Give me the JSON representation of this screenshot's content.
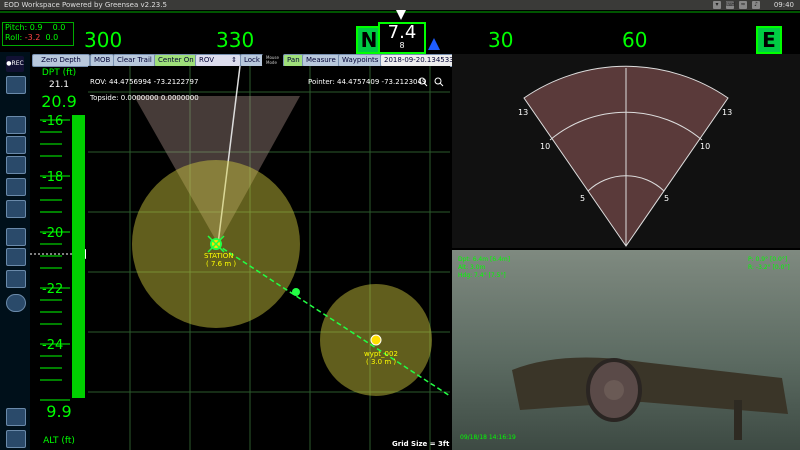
{
  "system_bar": {
    "title": "EOD Workspace Powered by Greensea v2.23.5",
    "clock": "09:40"
  },
  "attitude": {
    "pitch_label": "Pitch:",
    "pitch_a": "0.9",
    "pitch_b": "0.0",
    "roll_label": "Roll:",
    "roll_a": "-3.2",
    "roll_b": "0.0"
  },
  "compass": {
    "ticks": [
      "300",
      "330",
      "30",
      "60"
    ],
    "north": "N",
    "east": "E",
    "heading": "7.4",
    "heading_sub": "8"
  },
  "depth_gauge": {
    "title": "DPT (ft)",
    "setpoint": "21.1",
    "current": "20.9",
    "ticks": [
      "-16",
      "-18",
      "-20",
      "-22",
      "-24"
    ],
    "altitude": "9.9",
    "alt_label": "ALT (ft)"
  },
  "toolbar": {
    "zero_depth": "Zero Depth",
    "mob": "MOB",
    "clear_trail": "Clear Trail",
    "center_on": "Center On",
    "center_select": "ROV",
    "lock": "Lock",
    "mouse_mode": "Mouse Mode",
    "pan": "Pan",
    "measure": "Measure",
    "waypoints": "Waypoints",
    "timestamp": "2018-09-20.134533"
  },
  "map": {
    "rov_pos": "ROV: 44.4756994 -73.2122797",
    "topside_pos": "Topside: 0.0000000 0.0000000",
    "pointer_pos": "Pointer: 44.4757409 -73.2123049",
    "station_label": "STATION",
    "station_radius": "( 7.6 m )",
    "wypt_label": "wypt_002",
    "wypt_radius": "( 3.0 m )",
    "grid_size": "Grid Size = 3ft"
  },
  "sonar": {
    "ring_labels": [
      "13",
      "13",
      "10",
      "10",
      "5",
      "5"
    ]
  },
  "camera": {
    "dpt": "Dpt: 6.4m [6.4m]",
    "alt": "Alt: 3.0m",
    "hdg": "Hdg: 7.4° [7.5°]",
    "p": "P: 0.9° [0.0°]",
    "r": "R: -3.2° [0.0°]",
    "datetime": "09/18/18 14:16:19"
  }
}
